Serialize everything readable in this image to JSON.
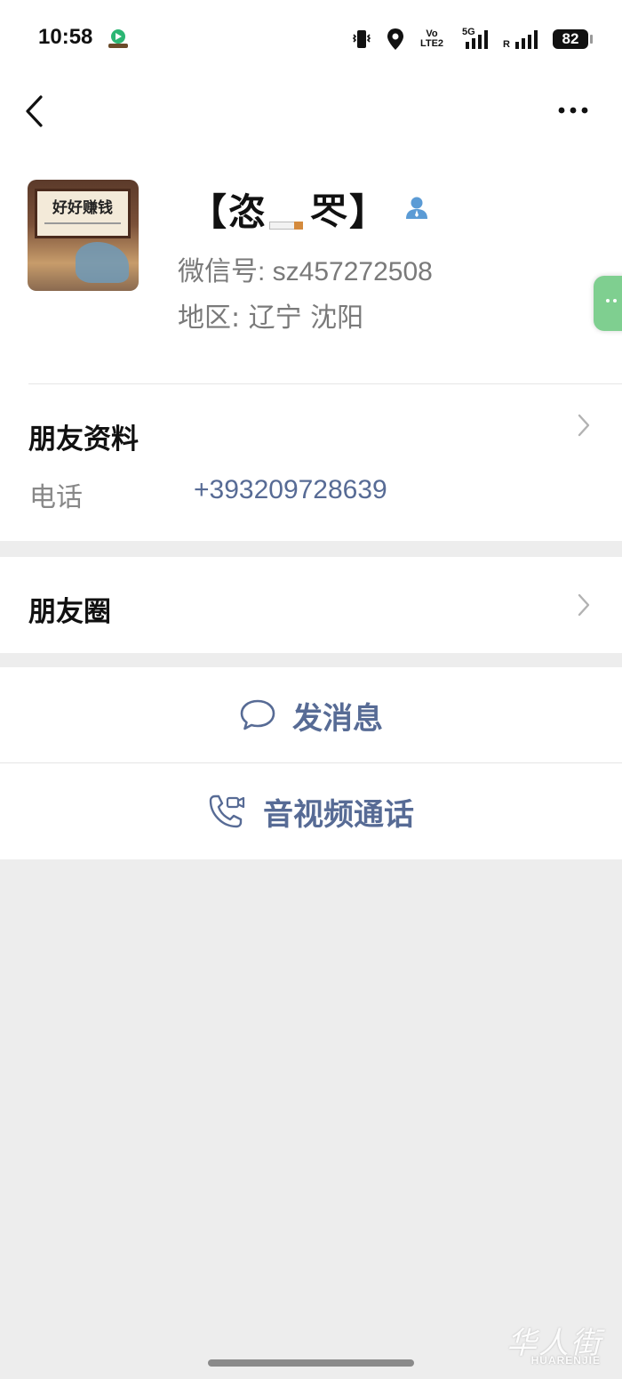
{
  "status_bar": {
    "time": "10:58",
    "network_1": "Vo LTE2",
    "network_2": "5G",
    "roaming": "R",
    "battery": "82"
  },
  "nav": {
    "back_icon": "chevron-left-icon",
    "more_icon": "more-dots-icon"
  },
  "profile": {
    "avatar_text": "好好赚钱",
    "name_left": "【恣",
    "name_right": "罖】",
    "wechat_id": "微信号: sz457272508",
    "region": "地区: 辽宁  沈阳"
  },
  "friend_info": {
    "title": "朋友资料",
    "phone_label": "电话",
    "phone_value": "+393209728639"
  },
  "moments": {
    "title": "朋友圈"
  },
  "actions": {
    "message": "发消息",
    "call": "音视频通话"
  },
  "watermark": {
    "cn": "华人街",
    "en": "HUARENJIE"
  },
  "colors": {
    "link": "#576b95",
    "bg": "#ededed",
    "side_tab": "#7fcf90"
  }
}
